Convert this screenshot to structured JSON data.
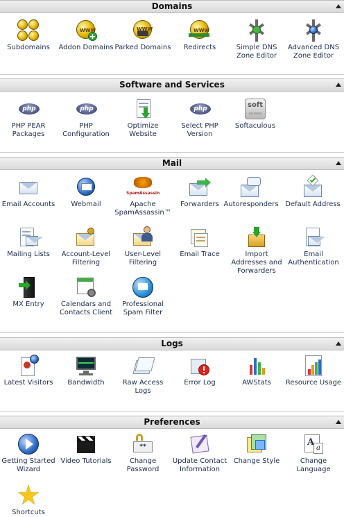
{
  "groups": {
    "domains": {
      "title": "Domains",
      "items": [
        {
          "label": "Subdomains",
          "icon": "subdomains-icon"
        },
        {
          "label": "Addon Domains",
          "icon": "addon-domains-icon"
        },
        {
          "label": "Parked Domains",
          "icon": "parked-domains-icon"
        },
        {
          "label": "Redirects",
          "icon": "redirects-icon"
        },
        {
          "label": "Simple DNS Zone Editor",
          "icon": "simple-dns-icon"
        },
        {
          "label": "Advanced DNS Zone Editor",
          "icon": "advanced-dns-icon"
        }
      ]
    },
    "software": {
      "title": "Software and Services",
      "items": [
        {
          "label": "PHP PEAR Packages",
          "icon": "php-icon"
        },
        {
          "label": "PHP Configuration",
          "icon": "php-icon"
        },
        {
          "label": "Optimize Website",
          "icon": "optimize-website-icon"
        },
        {
          "label": "Select PHP Version",
          "icon": "php-icon"
        },
        {
          "label": "Softaculous",
          "icon": "softaculous-icon"
        }
      ],
      "softaculous_logo": "soft",
      "softaculous_logo_sub": "aculous"
    },
    "mail": {
      "title": "Mail",
      "items": [
        {
          "label": "Email Accounts",
          "icon": "email-accounts-icon"
        },
        {
          "label": "Webmail",
          "icon": "webmail-icon"
        },
        {
          "label": "Apache SpamAssassin™",
          "icon": "spamassassin-icon"
        },
        {
          "label": "Forwarders",
          "icon": "forwarders-icon"
        },
        {
          "label": "Autoresponders",
          "icon": "autoresponders-icon"
        },
        {
          "label": "Default Address",
          "icon": "default-address-icon"
        },
        {
          "label": "Mailing Lists",
          "icon": "mailing-lists-icon"
        },
        {
          "label": "Account-Level Filtering",
          "icon": "account-filtering-icon"
        },
        {
          "label": "User-Level Filtering",
          "icon": "user-filtering-icon"
        },
        {
          "label": "Email Trace",
          "icon": "email-trace-icon"
        },
        {
          "label": "Import Addresses and Forwarders",
          "icon": "import-addresses-icon"
        },
        {
          "label": "Email Authentication",
          "icon": "email-authentication-icon"
        },
        {
          "label": "MX Entry",
          "icon": "mx-entry-icon"
        },
        {
          "label": "Calendars and Contacts Client",
          "icon": "calendars-icon"
        },
        {
          "label": "Professional Spam Filter",
          "icon": "spam-filter-icon"
        }
      ],
      "spamassassin_logo": "SpamAssassin"
    },
    "logs": {
      "title": "Logs",
      "items": [
        {
          "label": "Latest Visitors",
          "icon": "latest-visitors-icon"
        },
        {
          "label": "Bandwidth",
          "icon": "bandwidth-icon"
        },
        {
          "label": "Raw Access Logs",
          "icon": "raw-logs-icon"
        },
        {
          "label": "Error Log",
          "icon": "error-log-icon"
        },
        {
          "label": "AWStats",
          "icon": "awstats-icon"
        },
        {
          "label": "Resource Usage",
          "icon": "resource-usage-icon"
        }
      ]
    },
    "preferences": {
      "title": "Preferences",
      "items": [
        {
          "label": "Getting Started Wizard",
          "icon": "wizard-icon"
        },
        {
          "label": "Video Tutorials",
          "icon": "video-tutorials-icon"
        },
        {
          "label": "Change Password",
          "icon": "change-password-icon"
        },
        {
          "label": "Update Contact Information",
          "icon": "contact-info-icon"
        },
        {
          "label": "Change Style",
          "icon": "change-style-icon"
        },
        {
          "label": "Change Language",
          "icon": "change-language-icon"
        },
        {
          "label": "Shortcuts",
          "icon": "shortcuts-icon"
        }
      ]
    }
  },
  "colors": {
    "header_bg": "#e3e3e3",
    "label_text": "#20304f",
    "php_badge": "#4c5586",
    "globe_gold": "#e3b300"
  }
}
